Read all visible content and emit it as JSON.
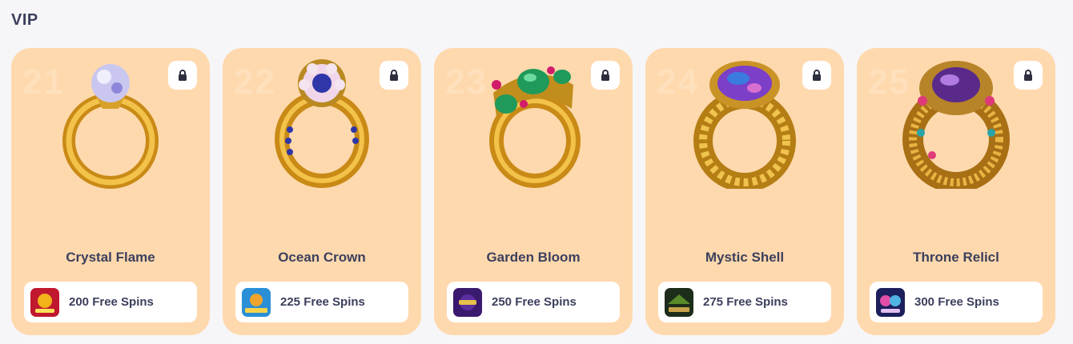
{
  "section": {
    "title": "VIP"
  },
  "cards": [
    {
      "title": "Crystal Flame",
      "reward": "200 Free Spins",
      "badge": "21",
      "gem_color": "#c9c7f0",
      "gem_accent": "#8e86d8",
      "thumb_colors": [
        "#c0182e",
        "#f2b21a"
      ]
    },
    {
      "title": "Ocean Crown",
      "reward": "225 Free Spins",
      "badge": "22",
      "gem_color": "#2e36a8",
      "gem_accent": "#f0d6e8",
      "thumb_colors": [
        "#2a8fd6",
        "#f0a42c"
      ]
    },
    {
      "title": "Garden Bloom",
      "reward": "250 Free Spins",
      "badge": "23",
      "gem_color": "#1f9a5a",
      "gem_accent": "#d21c6a",
      "thumb_colors": [
        "#3a1a6e",
        "#e6c14b"
      ]
    },
    {
      "title": "Mystic Shell",
      "reward": "275 Free Spins",
      "badge": "24",
      "gem_color": "#7b3fc8",
      "gem_accent": "#3a7be0",
      "thumb_colors": [
        "#1c2d1a",
        "#c9a24a"
      ]
    },
    {
      "title": "Throne Relicl",
      "reward": "300 Free Spins",
      "badge": "25",
      "gem_color": "#5a2a8a",
      "gem_accent": "#e0397a",
      "thumb_colors": [
        "#1c1f5c",
        "#e34fa8"
      ]
    }
  ],
  "icons": {
    "lock": "lock-icon"
  }
}
